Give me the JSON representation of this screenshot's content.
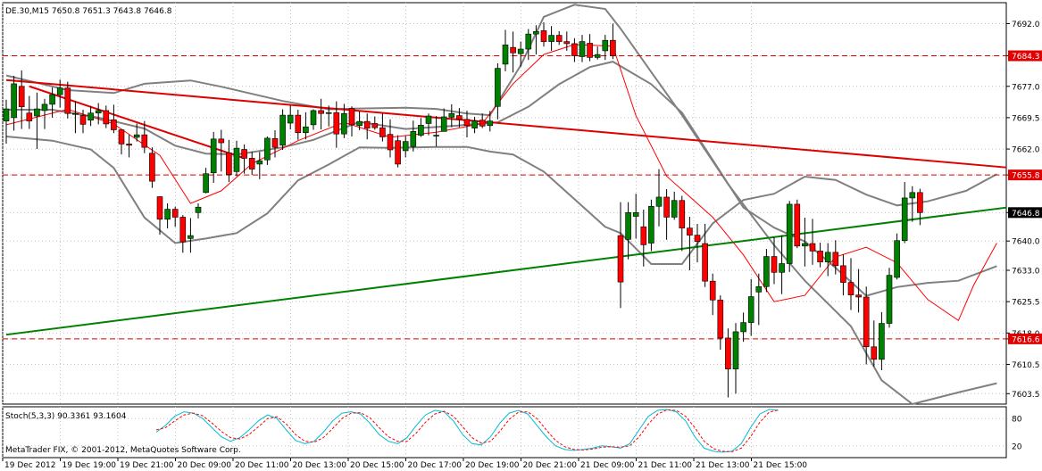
{
  "header": {
    "symbol": "DE.30,M15",
    "ohlc": "7650.8 7651.3 7643.8 7646.8"
  },
  "indicator": {
    "label": "Stoch(5,3,3) 90.3361 93.1604",
    "levels": [
      "80",
      "20"
    ]
  },
  "footer": {
    "copyright": "MetaTrader FIX, © 2001-2012, MetaQuotes Software Corp."
  },
  "colors": {
    "background": "#ffffff",
    "grid": "#c0c0c0",
    "bull_candle": "#008000",
    "bear_candle": "#ff0000",
    "wick": "#000000",
    "bollinger": "#808080",
    "ma": "#ff0000",
    "resistance_line": "#e00000",
    "support_line": "#008000",
    "level_line": "#e00000",
    "stoch_main": "#00bcd4",
    "stoch_signal": "#ff0000"
  },
  "chart_data": {
    "type": "candlestick",
    "title": "DE.30,M15",
    "ylim": [
      7601,
      7697
    ],
    "y_ticks": [
      "7692.0",
      "7684.3",
      "7677.0",
      "7669.5",
      "7662.0",
      "7655.8",
      "7646.8",
      "7640.0",
      "7633.0",
      "7625.5",
      "7618.0",
      "7616.6",
      "7610.5",
      "7603.5"
    ],
    "x_ticks": [
      "19 Dec 2012",
      "19 Dec 19:00",
      "19 Dec 21:00",
      "20 Dec 09:00",
      "20 Dec 11:00",
      "20 Dec 13:00",
      "20 Dec 15:00",
      "20 Dec 17:00",
      "20 Dec 19:00",
      "20 Dec 21:00",
      "21 Dec 09:00",
      "21 Dec 11:00",
      "21 Dec 13:00",
      "21 Dec 15:00"
    ],
    "horizontal_levels": [
      {
        "value": 7684.3,
        "label": "7684.3"
      },
      {
        "value": 7655.8,
        "label": "7655.8"
      },
      {
        "value": 7616.6,
        "label": "7616.6"
      }
    ],
    "current_price": {
      "value": 7646.8,
      "label": "7646.8"
    },
    "trendlines": [
      {
        "name": "resistance",
        "points": [
          [
            0,
            7678.5
          ],
          [
            141,
            7657.6
          ]
        ]
      },
      {
        "name": "support",
        "points": [
          [
            0,
            7617.6
          ],
          [
            141,
            7648.0
          ]
        ]
      },
      {
        "name": "short-resistance",
        "points": [
          [
            3,
            7677.0
          ],
          [
            31,
            7659.8
          ]
        ]
      }
    ],
    "bars_x_start": 0,
    "candles": [
      [
        7668.7,
        7673.8,
        7663.3,
        7671.6
      ],
      [
        7669.5,
        7679.5,
        7666.4,
        7677.6
      ],
      [
        7677.0,
        7680.8,
        7666.8,
        7672.1
      ],
      [
        7670.6,
        7674.7,
        7666.8,
        7668.7
      ],
      [
        7669.9,
        7675.5,
        7662.0,
        7671.6
      ],
      [
        7671.2,
        7674.0,
        7666.8,
        7672.7
      ],
      [
        7672.7,
        7676.7,
        7669.5,
        7675.0
      ],
      [
        7675.0,
        7678.6,
        7671.9,
        7676.6
      ],
      [
        7676.6,
        7678.1,
        7669.3,
        7670.5
      ],
      [
        7670.5,
        7673.4,
        7665.8,
        7670.5
      ],
      [
        7670.0,
        7671.4,
        7665.8,
        7667.9
      ],
      [
        7668.9,
        7672.3,
        7667.5,
        7670.6
      ],
      [
        7670.6,
        7673.0,
        7667.9,
        7671.2
      ],
      [
        7671.2,
        7672.4,
        7667.0,
        7668.0
      ],
      [
        7669.0,
        7672.6,
        7665.8,
        7666.6
      ],
      [
        7666.6,
        7666.8,
        7660.7,
        7663.2
      ],
      [
        7663.2,
        7665.4,
        7660.0,
        7662.9
      ],
      [
        7664.8,
        7668.1,
        7663.8,
        7665.4
      ],
      [
        7665.4,
        7668.7,
        7661.0,
        7662.4
      ],
      [
        7661.0,
        7662.4,
        7652.7,
        7654.3
      ],
      [
        7650.6,
        7650.7,
        7641.5,
        7645.2
      ],
      [
        7645.2,
        7649.0,
        7643.0,
        7647.6
      ],
      [
        7647.6,
        7648.2,
        7643.4,
        7645.7
      ],
      [
        7645.7,
        7646.2,
        7637.2,
        7639.8
      ],
      [
        7640.6,
        7645.5,
        7637.2,
        7641.3
      ],
      [
        7646.8,
        7649.0,
        7645.4,
        7648.1
      ],
      [
        7651.6,
        7657.5,
        7651.4,
        7656.1
      ],
      [
        7656.3,
        7666.1,
        7653.9,
        7664.4
      ],
      [
        7664.4,
        7666.6,
        7656.6,
        7663.5
      ],
      [
        7661.1,
        7664.2,
        7654.1,
        7655.9
      ],
      [
        7656.6,
        7664.0,
        7655.5,
        7662.2
      ],
      [
        7661.9,
        7663.1,
        7656.1,
        7659.8
      ],
      [
        7659.8,
        7661.4,
        7655.8,
        7657.2
      ],
      [
        7658.4,
        7661.3,
        7654.8,
        7659.2
      ],
      [
        7659.4,
        7665.0,
        7658.2,
        7664.6
      ],
      [
        7664.5,
        7666.5,
        7660.0,
        7662.4
      ],
      [
        7662.9,
        7671.5,
        7661.8,
        7670.1
      ],
      [
        7668.2,
        7672.4,
        7666.7,
        7670.1
      ],
      [
        7670.1,
        7671.4,
        7664.2,
        7665.9
      ],
      [
        7665.9,
        7670.8,
        7664.3,
        7667.3
      ],
      [
        7667.8,
        7671.5,
        7666.6,
        7671.2
      ],
      [
        7671.2,
        7674.0,
        7666.7,
        7670.5
      ],
      [
        7670.5,
        7672.4,
        7667.4,
        7670.7
      ],
      [
        7670.7,
        7673.4,
        7662.3,
        7665.6
      ],
      [
        7665.6,
        7672.8,
        7664.6,
        7670.5
      ],
      [
        7671.7,
        7672.2,
        7665.0,
        7667.8
      ],
      [
        7667.6,
        7671.0,
        7666.5,
        7668.6
      ],
      [
        7668.6,
        7670.5,
        7664.3,
        7667.0
      ],
      [
        7668.1,
        7669.8,
        7666.6,
        7667.1
      ],
      [
        7667.1,
        7670.5,
        7663.8,
        7664.9
      ],
      [
        7665.5,
        7669.1,
        7660.0,
        7661.8
      ],
      [
        7664.0,
        7665.3,
        7657.6,
        7658.4
      ],
      [
        7661.6,
        7665.1,
        7660.0,
        7663.8
      ],
      [
        7662.6,
        7668.8,
        7661.4,
        7666.2
      ],
      [
        7665.3,
        7669.4,
        7664.9,
        7667.7
      ],
      [
        7668.1,
        7670.5,
        7665.3,
        7669.9
      ],
      [
        7665.3,
        7669.9,
        7662.6,
        7665.3
      ],
      [
        7666.2,
        7671.7,
        7666.2,
        7669.7
      ],
      [
        7669.6,
        7672.7,
        7667.2,
        7670.5
      ],
      [
        7670.0,
        7671.8,
        7667.2,
        7669.1
      ],
      [
        7669.1,
        7671.2,
        7664.8,
        7667.6
      ],
      [
        7667.0,
        7669.7,
        7665.8,
        7668.7
      ],
      [
        7668.9,
        7670.5,
        7667.0,
        7667.5
      ],
      [
        7667.6,
        7671.1,
        7666.2,
        7668.7
      ],
      [
        7672.2,
        7682.5,
        7669.1,
        7681.3
      ],
      [
        7682.3,
        7690.5,
        7680.6,
        7686.9
      ],
      [
        7686.3,
        7690.1,
        7680.3,
        7685.0
      ],
      [
        7684.8,
        7687.7,
        7681.7,
        7685.9
      ],
      [
        7685.9,
        7690.7,
        7683.3,
        7689.5
      ],
      [
        7689.5,
        7691.6,
        7684.6,
        7690.1
      ],
      [
        7690.3,
        7692.3,
        7686.5,
        7687.7
      ],
      [
        7687.7,
        7691.4,
        7685.5,
        7689.2
      ],
      [
        7689.2,
        7690.2,
        7686.9,
        7687.7
      ],
      [
        7687.7,
        7690.1,
        7685.5,
        7687.2
      ],
      [
        7687.2,
        7688.5,
        7682.8,
        7684.3
      ],
      [
        7684.1,
        7689.3,
        7682.8,
        7687.7
      ],
      [
        7687.3,
        7689.5,
        7683.0,
        7683.9
      ],
      [
        7683.9,
        7686.5,
        7683.4,
        7684.6
      ],
      [
        7685.5,
        7689.3,
        7683.3,
        7688.0
      ],
      [
        7688.0,
        7692.0,
        7683.5,
        7684.3
      ],
      [
        7641.3,
        7649.3,
        7624.0,
        7630.2
      ],
      [
        7640.4,
        7649.3,
        7635.6,
        7646.8
      ],
      [
        7645.9,
        7651.3,
        7640.6,
        7646.8
      ],
      [
        7643.4,
        7647.5,
        7633.9,
        7639.1
      ],
      [
        7639.5,
        7649.9,
        7637.6,
        7648.3
      ],
      [
        7648.3,
        7657.2,
        7643.5,
        7650.5
      ],
      [
        7650.5,
        7652.4,
        7640.3,
        7645.7
      ],
      [
        7645.7,
        7651.8,
        7645.1,
        7649.7
      ],
      [
        7649.7,
        7650.8,
        7637.6,
        7643.1
      ],
      [
        7643.1,
        7645.8,
        7633.0,
        7641.4
      ],
      [
        7641.4,
        7644.1,
        7634.9,
        7639.9
      ],
      [
        7639.4,
        7644.1,
        7629.0,
        7630.4
      ],
      [
        7630.4,
        7632.2,
        7622.3,
        7625.9
      ],
      [
        7625.9,
        7627.0,
        7614.0,
        7616.8
      ],
      [
        7616.8,
        7619.1,
        7602.6,
        7609.4
      ],
      [
        7609.4,
        7620.4,
        7603.5,
        7618.3
      ],
      [
        7618.3,
        7622.9,
        7615.9,
        7620.5
      ],
      [
        7620.5,
        7630.9,
        7617.3,
        7626.7
      ],
      [
        7627.8,
        7632.2,
        7619.9,
        7629.1
      ],
      [
        7629.1,
        7638.1,
        7627.8,
        7636.3
      ],
      [
        7636.3,
        7640.9,
        7629.7,
        7632.5
      ],
      [
        7632.5,
        7641.4,
        7627.3,
        7634.6
      ],
      [
        7634.6,
        7649.6,
        7632.6,
        7648.8
      ],
      [
        7648.8,
        7649.9,
        7638.3,
        7638.8
      ],
      [
        7638.8,
        7645.6,
        7633.9,
        7639.4
      ],
      [
        7639.4,
        7645.3,
        7634.3,
        7637.6
      ],
      [
        7637.6,
        7639.6,
        7633.7,
        7635.0
      ],
      [
        7635.0,
        7639.5,
        7631.6,
        7637.3
      ],
      [
        7637.3,
        7640.2,
        7632.0,
        7634.1
      ],
      [
        7634.1,
        7636.8,
        7627.0,
        7630.1
      ],
      [
        7630.1,
        7635.9,
        7623.5,
        7627.1
      ],
      [
        7627.1,
        7633.3,
        7622.9,
        7626.6
      ],
      [
        7626.6,
        7629.1,
        7610.5,
        7614.7
      ],
      [
        7614.7,
        7621.0,
        7610.0,
        7611.7
      ],
      [
        7611.7,
        7623.0,
        7609.1,
        7620.3
      ],
      [
        7620.3,
        7633.6,
        7619.3,
        7631.8
      ],
      [
        7631.3,
        7641.8,
        7630.8,
        7640.1
      ],
      [
        7640.1,
        7654.1,
        7639.5,
        7650.3
      ],
      [
        7650.3,
        7653.1,
        7644.6,
        7651.6
      ],
      [
        7651.6,
        7652.5,
        7643.8,
        7646.8
      ]
    ],
    "bollinger_upper": [
      [
        0,
        7679.6
      ],
      [
        8,
        7676.1
      ],
      [
        14,
        7675.4
      ],
      [
        18,
        7677.6
      ],
      [
        24,
        7678.4
      ],
      [
        28,
        7676.9
      ],
      [
        36,
        7673.5
      ],
      [
        42,
        7671.5
      ],
      [
        46,
        7671.7
      ],
      [
        52,
        7671.9
      ],
      [
        56,
        7671.6
      ],
      [
        60,
        7670.5
      ],
      [
        63,
        7670.1
      ],
      [
        67,
        7682.0
      ],
      [
        70,
        7693.6
      ],
      [
        74,
        7696.5
      ],
      [
        78,
        7695.5
      ],
      [
        80,
        7690.8
      ],
      [
        84,
        7680.4
      ],
      [
        88,
        7670.1
      ],
      [
        94,
        7653.6
      ],
      [
        100,
        7639.0
      ],
      [
        104,
        7630.5
      ],
      [
        110,
        7619.6
      ],
      [
        114,
        7606.7
      ],
      [
        118,
        7601.0
      ],
      [
        124,
        7603.8
      ],
      [
        129,
        7606.0
      ]
    ],
    "bollinger_mid": [
      [
        0,
        7671.4
      ],
      [
        6,
        7671.4
      ],
      [
        12,
        7669.5
      ],
      [
        18,
        7666.9
      ],
      [
        22,
        7662.8
      ],
      [
        26,
        7660.9
      ],
      [
        30,
        7660.7
      ],
      [
        36,
        7662.4
      ],
      [
        40,
        7664.2
      ],
      [
        46,
        7668.5
      ],
      [
        52,
        7666.8
      ],
      [
        58,
        7667.5
      ],
      [
        64,
        7668.4
      ],
      [
        68,
        7672.1
      ],
      [
        72,
        7677.5
      ],
      [
        76,
        7681.6
      ],
      [
        79,
        7682.9
      ],
      [
        84,
        7677.5
      ],
      [
        88,
        7670.7
      ],
      [
        92,
        7659.4
      ],
      [
        96,
        7648.0
      ],
      [
        100,
        7643.2
      ],
      [
        104,
        7639.9
      ],
      [
        108,
        7633.6
      ],
      [
        112,
        7626.9
      ],
      [
        116,
        7629.0
      ],
      [
        120,
        7630.0
      ],
      [
        124,
        7630.5
      ],
      [
        129,
        7634.0
      ]
    ],
    "bollinger_lower": [
      [
        0,
        7665.0
      ],
      [
        6,
        7664.0
      ],
      [
        11,
        7661.9
      ],
      [
        14,
        7657.5
      ],
      [
        18,
        7645.6
      ],
      [
        22,
        7639.5
      ],
      [
        26,
        7640.6
      ],
      [
        30,
        7641.9
      ],
      [
        34,
        7646.6
      ],
      [
        38,
        7654.5
      ],
      [
        42,
        7658.3
      ],
      [
        46,
        7662.4
      ],
      [
        50,
        7662.3
      ],
      [
        56,
        7662.5
      ],
      [
        60,
        7662.5
      ],
      [
        63,
        7661.4
      ],
      [
        66,
        7660.7
      ],
      [
        70,
        7656.6
      ],
      [
        74,
        7650.0
      ],
      [
        78,
        7643.4
      ],
      [
        80,
        7641.9
      ],
      [
        84,
        7634.5
      ],
      [
        88,
        7634.5
      ],
      [
        92,
        7644.2
      ],
      [
        96,
        7649.8
      ],
      [
        100,
        7651.3
      ],
      [
        104,
        7655.4
      ],
      [
        108,
        7654.6
      ],
      [
        112,
        7651.1
      ],
      [
        116,
        7648.5
      ],
      [
        120,
        7649.5
      ],
      [
        125,
        7652.0
      ],
      [
        129,
        7656.0
      ]
    ],
    "ma_points": [
      [
        0,
        7667.8
      ],
      [
        8,
        7671.5
      ],
      [
        14,
        7668.0
      ],
      [
        20,
        7660.5
      ],
      [
        24,
        7649.0
      ],
      [
        28,
        7652.0
      ],
      [
        32,
        7658.5
      ],
      [
        38,
        7664.0
      ],
      [
        44,
        7668.4
      ],
      [
        50,
        7664.8
      ],
      [
        56,
        7666.0
      ],
      [
        62,
        7668.1
      ],
      [
        66,
        7677.6
      ],
      [
        70,
        7684.6
      ],
      [
        74,
        7687.0
      ],
      [
        79,
        7686.6
      ],
      [
        82,
        7670.0
      ],
      [
        86,
        7655.5
      ],
      [
        92,
        7645.7
      ],
      [
        96,
        7636.7
      ],
      [
        100,
        7625.5
      ],
      [
        104,
        7627.0
      ],
      [
        108,
        7636.2
      ],
      [
        112,
        7638.5
      ],
      [
        116,
        7634.8
      ],
      [
        120,
        7626.0
      ],
      [
        124,
        7621.0
      ],
      [
        126,
        7629.5
      ],
      [
        129,
        7639.5
      ]
    ],
    "stochastic": {
      "main": [
        50,
        65,
        85,
        95,
        92,
        80,
        60,
        40,
        30,
        38,
        55,
        75,
        88,
        80,
        55,
        32,
        25,
        30,
        50,
        75,
        92,
        95,
        90,
        70,
        45,
        30,
        25,
        38,
        65,
        88,
        98,
        95,
        75,
        45,
        25,
        22,
        40,
        70,
        92,
        98,
        90,
        65,
        40,
        20,
        12,
        10,
        12,
        15,
        20,
        18,
        15,
        25,
        55,
        85,
        98,
        100,
        95,
        75,
        40,
        15,
        8,
        6,
        8,
        25,
        60,
        90,
        100,
        98
      ],
      "signal": [
        55,
        60,
        75,
        88,
        92,
        86,
        70,
        52,
        38,
        35,
        45,
        62,
        80,
        84,
        68,
        45,
        30,
        28,
        38,
        58,
        80,
        92,
        93,
        82,
        60,
        40,
        30,
        30,
        48,
        72,
        90,
        96,
        85,
        62,
        38,
        26,
        30,
        52,
        78,
        94,
        95,
        80,
        55,
        32,
        18,
        12,
        11,
        13,
        17,
        18,
        17,
        20,
        40,
        68,
        90,
        99,
        98,
        85,
        60,
        30,
        14,
        8,
        7,
        15,
        40,
        72,
        94,
        99
      ]
    }
  }
}
